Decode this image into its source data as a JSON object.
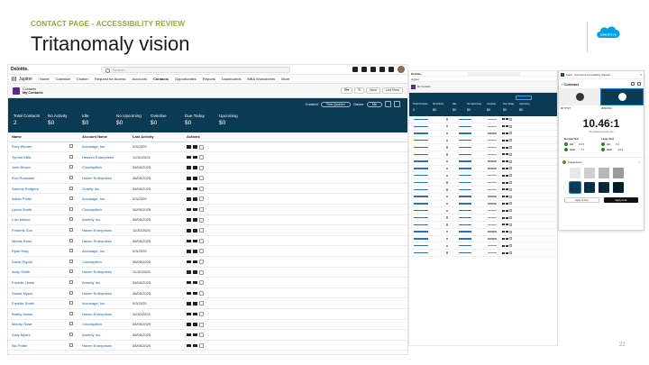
{
  "slide": {
    "kicker": "CONTACT PAGE - ACCESSIBILITY REVIEW",
    "title": "Tritanomaly vision",
    "page_number": "22",
    "logo_text": "salesforce"
  },
  "app": {
    "brand": "Deloitte.",
    "search_placeholder": "Search...",
    "app_name": "Jupiter",
    "nav": [
      "Home",
      "Calendar",
      "Chatter",
      "Request for Access",
      "Accounts",
      "Contacts",
      "Opportunities",
      "Reports",
      "Dashboards",
      "MBA Worksheets",
      "More"
    ],
    "list_object": "Contacts",
    "list_view": "My Contacts",
    "toolbar": {
      "new": "New",
      "list_view": "List View"
    },
    "filters": {
      "created_label": "Created",
      "created_value": "This Quarter",
      "owner_label": "Owner",
      "owner_value": "Me"
    },
    "kpis": [
      {
        "label": "Total Contacts",
        "value": "2"
      },
      {
        "label": "No Activity",
        "value": "$0"
      },
      {
        "label": "Idle",
        "value": "$0"
      },
      {
        "label": "No Upcoming",
        "value": "$0"
      },
      {
        "label": "Overdue",
        "value": "$0"
      },
      {
        "label": "Due Today",
        "value": "$0"
      },
      {
        "label": "Upcoming",
        "value": "$0"
      }
    ],
    "columns": [
      "Name",
      "Account Name",
      "Last Activity",
      "Actions"
    ],
    "rows": [
      [
        "Rory Winder",
        "Accusage, Inc.",
        "5/3/2025"
      ],
      [
        "Tyrone Mills",
        "Heaven Enterprises",
        "11/30/2025"
      ],
      [
        "Josh Brown",
        "Cloudsplitch",
        "08/05/2025"
      ],
      [
        "Rod Roswane",
        "Haven Enterprises",
        "08/05/2025"
      ],
      [
        "Sammy Rodgers",
        "Grasity Inc.",
        "08/05/2025"
      ],
      [
        "Isaiah Potter",
        "Accusage, Inc.",
        "5/3/2025"
      ],
      [
        "Lynda Smith",
        "Cloudsplitch",
        "08/05/2025"
      ],
      [
        "Lulu Mason",
        "Amerity Inc.",
        "08/05/2025"
      ],
      [
        "Frederik Son",
        "Haven Enterprises",
        "11/30/2025"
      ],
      [
        "Minnie Ross",
        "Haven Enterprises",
        "08/05/2025"
      ],
      [
        "Ryan King",
        "Accusage, Inc.",
        "5/3/2025"
      ],
      [
        "David Rigold",
        "Cloudsplitch",
        "08/05/2025"
      ],
      [
        "Andy Smith",
        "Haven Enterprises",
        "11/30/2025"
      ],
      [
        "Freddie Lewis",
        "Amerity Inc.",
        "08/05/2025"
      ],
      [
        "Susan Myers",
        "Haven Enterprises",
        "08/05/2025"
      ],
      [
        "Freddie Smith",
        "Accusage, Inc.",
        "5/3/2025"
      ],
      [
        "Bobby Hearn",
        "Haven Enterprises",
        "11/30/2025"
      ],
      [
        "Mandy Rose",
        "Cloudsplitch",
        "08/05/2025"
      ],
      [
        "Sally Myers",
        "Amerity Inc.",
        "08/05/2025"
      ],
      [
        "Nic Potter",
        "Haven Enterprises",
        "08/05/2025"
      ]
    ]
  },
  "panel": {
    "title": "Stark - Contrast & Accessibility Checker",
    "section": "Contrast",
    "fg_hex": "#F7F7F7",
    "bg_hex": "#0B3A54",
    "ratio": "10.46:1",
    "ratio_sub": "Simulated contrast ratio",
    "normal_text": "Normal Text",
    "large_text": "Large Text",
    "normal": [
      {
        "level": "AA",
        "req": "4.5:1"
      },
      {
        "level": "AAA",
        "req": "7:1"
      }
    ],
    "large": [
      {
        "level": "AA",
        "req": "3:1"
      },
      {
        "level": "AAA",
        "req": "4.5:1"
      }
    ],
    "suggestions": "Suggestions",
    "apply_fg": "Apply to fore",
    "apply_bg": "Apply to all",
    "swatch_colors": [
      "#e9e9e9",
      "#cfcfcf",
      "#b7b7b7",
      "#9a9a9a",
      "#0b3a54",
      "#0a3149",
      "#07263a",
      "#041a28"
    ]
  },
  "colors": {
    "band": "#0b3a54",
    "accent": "#8bab3a",
    "link": "#0b5cad"
  }
}
